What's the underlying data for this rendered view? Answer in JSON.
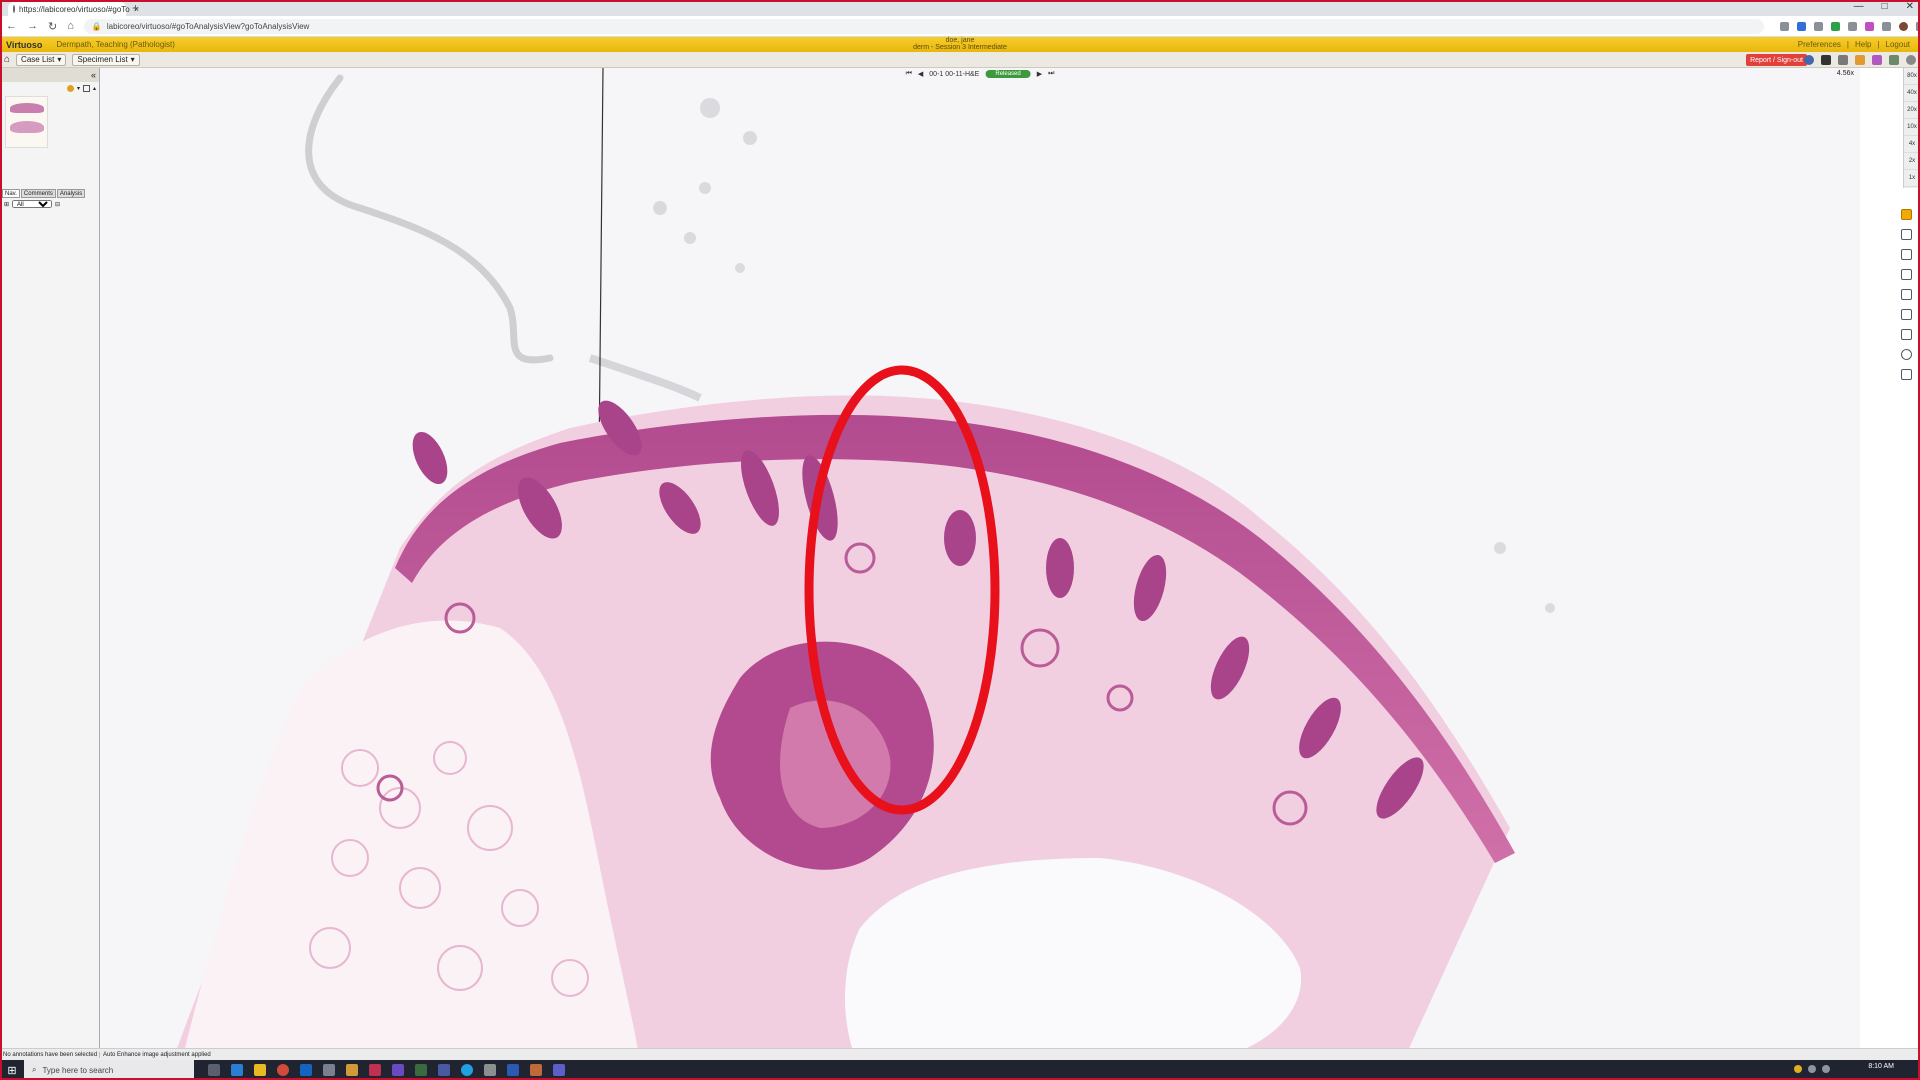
{
  "browser": {
    "tab_title": "https://labicoreo/virtuoso/#goTo",
    "tab_close": "×",
    "new_tab": "+",
    "url": "labicoreo/virtuoso/#goToAnalysisView?goToAnalysisView",
    "window_controls": [
      "—",
      "□",
      "✕"
    ]
  },
  "app": {
    "name": "Virtuoso",
    "institution": "Dermpath, Teaching (Pathologist)",
    "user_line1": "doe, jane",
    "user_line2": "derm - Session 3 Intermediate",
    "links": [
      "Preferences",
      "|",
      "Help",
      "|",
      "Logout"
    ]
  },
  "toolbar": {
    "home_icon": "⌂",
    "case_list": "Case List",
    "specimen_list": "Specimen List",
    "report_button": "Report / Sign-out"
  },
  "slide": {
    "label": "00-1 00-11-H&E",
    "status": "Released",
    "zoom": "4.56x"
  },
  "zoom_levels": [
    "80x",
    "40x",
    "20x",
    "10x",
    "4x",
    "2x",
    "1x"
  ],
  "left_panel": {
    "collapse": "«",
    "tabs": [
      "Nav.",
      "Comments",
      "Analysis"
    ],
    "filter_value": "All"
  },
  "status_bar": {
    "left": "No annotations have been selected",
    "right": "Auto Enhance image adjustment applied"
  },
  "taskbar": {
    "search_placeholder": "Type here to search",
    "time": "8:10 AM"
  },
  "colors": {
    "frame_border": "#c8102e",
    "header_yellow": "#f6cc2c",
    "annotation_red": "#e8101a",
    "report_button": "#e2403a",
    "released_green": "#3c9a3c"
  }
}
